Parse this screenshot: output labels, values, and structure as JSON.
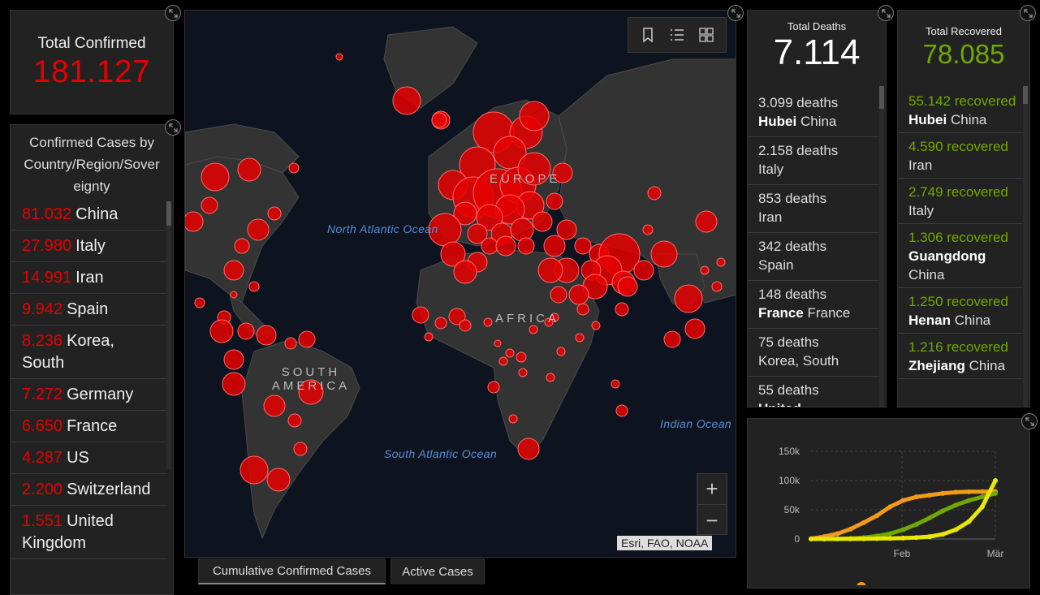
{
  "total_confirmed": {
    "label": "Total Confirmed",
    "value": "181.127"
  },
  "country_list": {
    "header": "Confirmed Cases by Country/Region/Sovereignty",
    "header_lines": [
      "Confirmed Cases by",
      "Country/Region/Sover",
      "eignty"
    ],
    "items": [
      {
        "value": "81.032",
        "name": "China"
      },
      {
        "value": "27.980",
        "name": "Italy"
      },
      {
        "value": "14.991",
        "name": "Iran"
      },
      {
        "value": "9.942",
        "name": "Spain"
      },
      {
        "value": "8.236",
        "name": "Korea, South"
      },
      {
        "value": "7.272",
        "name": "Germany"
      },
      {
        "value": "6.650",
        "name": "France"
      },
      {
        "value": "4.287",
        "name": "US"
      },
      {
        "value": "2.200",
        "name": "Switzerland"
      },
      {
        "value": "1.551",
        "name": "United Kingdom"
      }
    ]
  },
  "map": {
    "labels": {
      "north_atlantic": "North Atlantic Ocean",
      "south_atlantic": "South Atlantic Ocean",
      "indian": "Indian Ocean",
      "south_america": "SOUTH AMERICA",
      "africa": "AFRICA",
      "europe": "EUROPE"
    },
    "attribution": "Esri, FAO, NOAA",
    "zoom_in": "+",
    "zoom_out": "−"
  },
  "tabs": {
    "cumulative": "Cumulative Confirmed Cases",
    "active": "Active Cases"
  },
  "deaths": {
    "label": "Total Deaths",
    "value": "7.114",
    "items": [
      {
        "count": "3.099 deaths",
        "region": "Hubei",
        "country": "China"
      },
      {
        "count": "2.158 deaths",
        "region": "",
        "country": "Italy"
      },
      {
        "count": "853 deaths",
        "region": "",
        "country": "Iran"
      },
      {
        "count": "342 deaths",
        "region": "",
        "country": "Spain"
      },
      {
        "count": "148 deaths",
        "region": "France",
        "country": "France"
      },
      {
        "count": "75 deaths",
        "region": "",
        "country": "Korea, South"
      },
      {
        "count": "55 deaths",
        "region": "United",
        "country": ""
      }
    ]
  },
  "recovered": {
    "label": "Total Recovered",
    "value": "78.085",
    "items": [
      {
        "count": "55.142",
        "unit": "recovered",
        "region": "Hubei",
        "country": "China"
      },
      {
        "count": "4.590",
        "unit": "recovered",
        "region": "",
        "country": "Iran"
      },
      {
        "count": "2.749",
        "unit": "recovered",
        "region": "",
        "country": "Italy"
      },
      {
        "count": "1.306",
        "unit": "recovered",
        "region": "Guangdong",
        "country": "China"
      },
      {
        "count": "1.250",
        "unit": "recovered",
        "region": "Henan",
        "country": "China"
      },
      {
        "count": "1.216",
        "unit": "recovered",
        "region": "Zhejiang",
        "country": "China"
      }
    ]
  },
  "colors": {
    "confirmed": "#e60000",
    "recovered": "#70a800",
    "orange": "#f29a1a",
    "yellow": "#e8e800",
    "green": "#70a800"
  },
  "chart_data": {
    "type": "line",
    "title": "",
    "xlabel": "",
    "ylabel": "",
    "x_ticks": [
      "Feb",
      "Mär"
    ],
    "y_ticks": [
      "0",
      "50k",
      "100k",
      "150k"
    ],
    "ylim": [
      0,
      150000
    ],
    "grid": true,
    "series": [
      {
        "color": "#f29a1a",
        "values": [
          500,
          4000,
          9000,
          17000,
          28000,
          40000,
          55000,
          66000,
          72000,
          75000,
          78000,
          80000,
          80800,
          81000,
          81200
        ]
      },
      {
        "color": "#70a800",
        "values": [
          0,
          100,
          300,
          1000,
          2500,
          5000,
          9000,
          16000,
          25000,
          36000,
          48000,
          58000,
          66000,
          72000,
          78000
        ]
      },
      {
        "color": "#e8e800",
        "values": [
          0,
          50,
          100,
          200,
          400,
          700,
          1000,
          1500,
          2500,
          4000,
          8000,
          16000,
          30000,
          55000,
          100000
        ]
      }
    ]
  }
}
